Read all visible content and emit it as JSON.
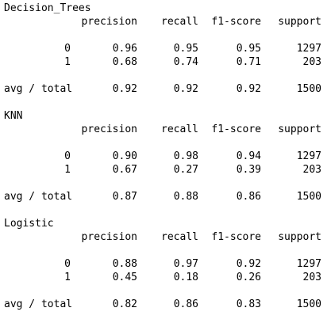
{
  "reports": [
    {
      "model": "Decision_Trees",
      "headers": [
        "precision",
        "recall",
        "f1-score",
        "support"
      ],
      "rows": [
        {
          "label": "0",
          "precision": "0.96",
          "recall": "0.95",
          "f1": "0.95",
          "support": "1297"
        },
        {
          "label": "1",
          "precision": "0.68",
          "recall": "0.74",
          "f1": "0.71",
          "support": "203"
        }
      ],
      "avg": {
        "label": "avg / total",
        "precision": "0.92",
        "recall": "0.92",
        "f1": "0.92",
        "support": "1500"
      }
    },
    {
      "model": "KNN",
      "headers": [
        "precision",
        "recall",
        "f1-score",
        "support"
      ],
      "rows": [
        {
          "label": "0",
          "precision": "0.90",
          "recall": "0.98",
          "f1": "0.94",
          "support": "1297"
        },
        {
          "label": "1",
          "precision": "0.67",
          "recall": "0.27",
          "f1": "0.39",
          "support": "203"
        }
      ],
      "avg": {
        "label": "avg / total",
        "precision": "0.87",
        "recall": "0.88",
        "f1": "0.86",
        "support": "1500"
      }
    },
    {
      "model": "Logistic",
      "headers": [
        "precision",
        "recall",
        "f1-score",
        "support"
      ],
      "rows": [
        {
          "label": "0",
          "precision": "0.88",
          "recall": "0.97",
          "f1": "0.92",
          "support": "1297"
        },
        {
          "label": "1",
          "precision": "0.45",
          "recall": "0.18",
          "f1": "0.26",
          "support": "203"
        }
      ],
      "avg": {
        "label": "avg / total",
        "precision": "0.82",
        "recall": "0.86",
        "f1": "0.83",
        "support": "1500"
      }
    }
  ]
}
